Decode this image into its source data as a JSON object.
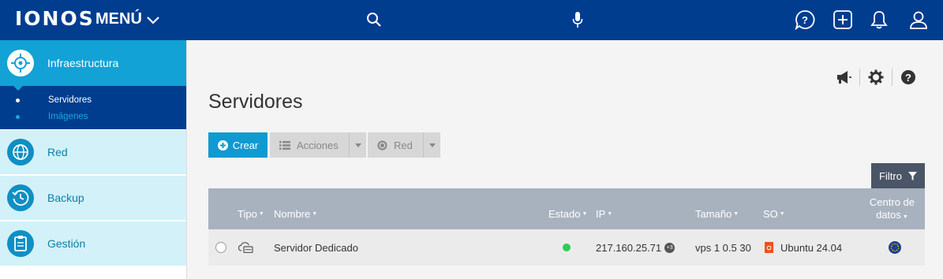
{
  "header": {
    "logo": "IONOS",
    "menu_label": "MENÚ",
    "icons": [
      "search-icon",
      "microphone-icon",
      "help-chat-icon",
      "add-icon",
      "notification-bell-icon",
      "user-icon"
    ]
  },
  "sidebar": {
    "active": {
      "label": "Infraestructura",
      "icon": "infrastructure-icon"
    },
    "subitems": [
      {
        "label": "Servidores",
        "active": true
      },
      {
        "label": "Imágenes",
        "active": false
      }
    ],
    "items": [
      {
        "label": "Red",
        "icon": "network-globe-icon"
      },
      {
        "label": "Backup",
        "icon": "backup-clock-icon"
      },
      {
        "label": "Gestión",
        "icon": "clipboard-icon"
      }
    ]
  },
  "main": {
    "title": "Servidores",
    "util_icons": [
      "megaphone-icon",
      "gear-icon",
      "help-icon"
    ],
    "toolbar": {
      "create_label": "Crear",
      "actions_label": "Acciones",
      "network_label": "Red"
    },
    "filter_label": "Filtro",
    "table": {
      "columns": {
        "type": "Tipo",
        "name": "Nombre",
        "status": "Estado",
        "ip": "IP",
        "size": "Tamaño",
        "os": "SO",
        "datacenter_line1": "Centro de",
        "datacenter_line2": "datos"
      },
      "rows": [
        {
          "name": "Servidor Dedicado",
          "status": "running",
          "ip": "217.160.25.71",
          "ip_extra": "+3",
          "size": "vps 1 0.5 30",
          "os": "Ubuntu 24.04",
          "datacenter": "eu-flag-icon"
        }
      ]
    }
  },
  "colors": {
    "topbar": "#003d8f",
    "accent": "#0f9ad1",
    "sidebar_active": "#12a2d6",
    "sidebar_inactive": "#d3f1f9",
    "table_header": "#a8b2bf",
    "status_ok": "#2ecc55",
    "ubuntu": "#e95420"
  }
}
